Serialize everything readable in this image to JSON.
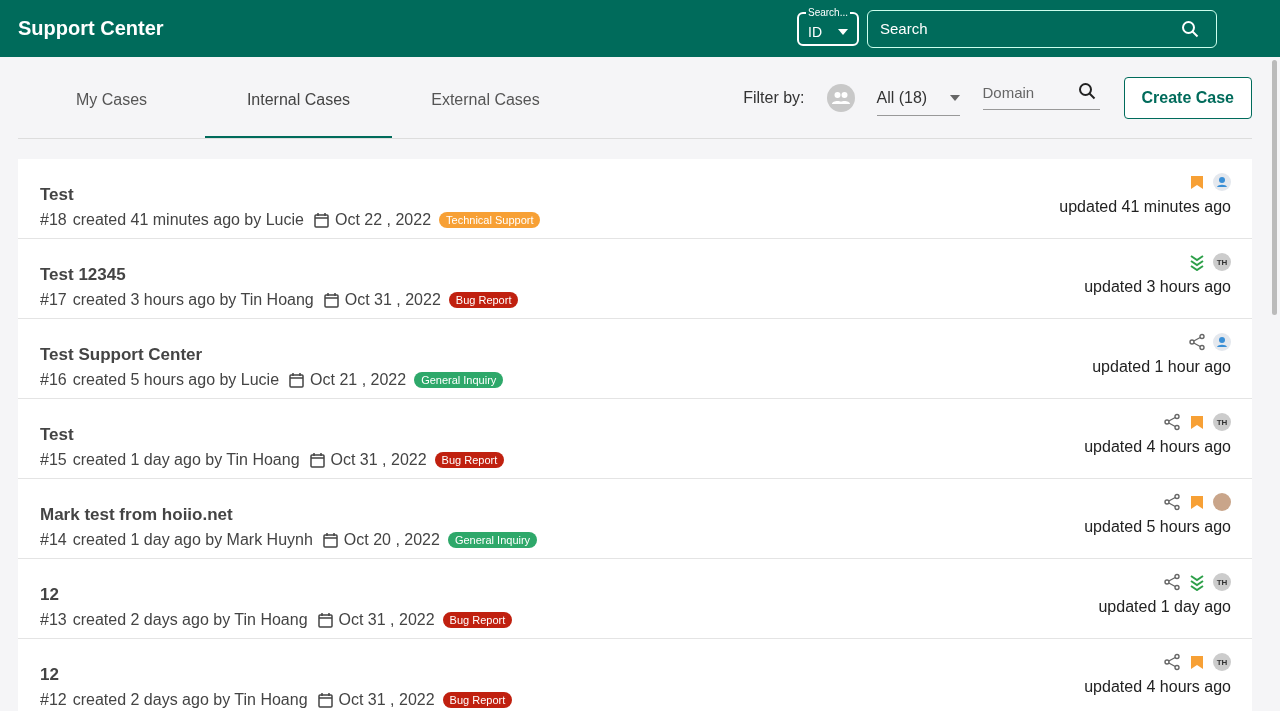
{
  "header": {
    "title": "Support Center",
    "search_type": {
      "label": "Search...",
      "value": "ID"
    },
    "search": {
      "placeholder": "Search"
    }
  },
  "tabs": [
    {
      "label": "My Cases",
      "selected": false
    },
    {
      "label": "Internal Cases",
      "selected": true
    },
    {
      "label": "External Cases",
      "selected": false
    }
  ],
  "filter": {
    "label": "Filter by:",
    "scope": "All (18)",
    "domain": {
      "placeholder": "Domain"
    }
  },
  "create_button": "Create Case",
  "cases": [
    {
      "title": "Test",
      "number": "#18",
      "created": "created 41 minutes ago by Lucie",
      "date": "Oct 22 , 2022",
      "tag": {
        "label": "Technical Support",
        "color": "#f7a035"
      },
      "shared": false,
      "bookmarked": true,
      "low_priority": false,
      "avatar": {
        "kind": "person"
      },
      "updated": "updated 41 minutes ago"
    },
    {
      "title": "Test 12345",
      "number": "#17",
      "created": "created 3 hours ago by Tin Hoang",
      "date": "Oct 31 , 2022",
      "tag": {
        "label": "Bug Report",
        "color": "#c0200f"
      },
      "shared": false,
      "bookmarked": false,
      "low_priority": true,
      "avatar": {
        "kind": "initials",
        "text": "TH"
      },
      "updated": "updated 3 hours ago"
    },
    {
      "title": "Test Support Center",
      "number": "#16",
      "created": "created 5 hours ago by Lucie",
      "date": "Oct 21 , 2022",
      "tag": {
        "label": "General Inquiry",
        "color": "#2ea86a"
      },
      "shared": true,
      "bookmarked": false,
      "low_priority": false,
      "avatar": {
        "kind": "person"
      },
      "updated": "updated 1 hour ago"
    },
    {
      "title": "Test",
      "number": "#15",
      "created": "created 1 day ago by Tin Hoang",
      "date": "Oct 31 , 2022",
      "tag": {
        "label": "Bug Report",
        "color": "#c0200f"
      },
      "shared": true,
      "bookmarked": true,
      "low_priority": false,
      "avatar": {
        "kind": "initials",
        "text": "TH"
      },
      "updated": "updated 4 hours ago"
    },
    {
      "title": "Mark test from hoiio.net",
      "number": "#14",
      "created": "created 1 day ago by Mark Huynh",
      "date": "Oct 20 , 2022",
      "tag": {
        "label": "General Inquiry",
        "color": "#2ea86a"
      },
      "shared": true,
      "bookmarked": true,
      "low_priority": false,
      "avatar": {
        "kind": "photo"
      },
      "updated": "updated 5 hours ago"
    },
    {
      "title": "12",
      "number": "#13",
      "created": "created 2 days ago by Tin Hoang",
      "date": "Oct 31 , 2022",
      "tag": {
        "label": "Bug Report",
        "color": "#c0200f"
      },
      "shared": true,
      "bookmarked": false,
      "low_priority": true,
      "avatar": {
        "kind": "initials",
        "text": "TH"
      },
      "updated": "updated 1 day ago"
    },
    {
      "title": "12",
      "number": "#12",
      "created": "created 2 days ago by Tin Hoang",
      "date": "Oct 31 , 2022",
      "tag": {
        "label": "Bug Report",
        "color": "#c0200f"
      },
      "shared": true,
      "bookmarked": true,
      "low_priority": false,
      "avatar": {
        "kind": "initials",
        "text": "TH"
      },
      "updated": "updated 4 hours ago"
    }
  ]
}
